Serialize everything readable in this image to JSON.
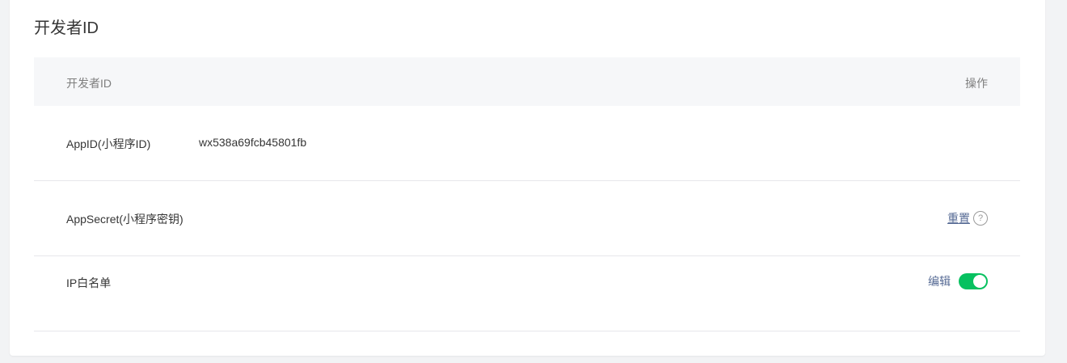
{
  "card": {
    "title": "开发者ID"
  },
  "table": {
    "headers": {
      "left": "开发者ID",
      "right": "操作"
    },
    "rows": [
      {
        "label": "AppID(小程序ID)",
        "value": "wx538a69fcb45801fb"
      },
      {
        "label": "AppSecret(小程序密钥)",
        "action_label": "重置",
        "help_icon": "?"
      },
      {
        "label": "IP白名单",
        "action_label": "编辑",
        "toggle_on": true
      }
    ]
  },
  "colors": {
    "accent_link": "#576b95",
    "toggle_on": "#07c160",
    "header_bg": "#f6f7f9"
  }
}
